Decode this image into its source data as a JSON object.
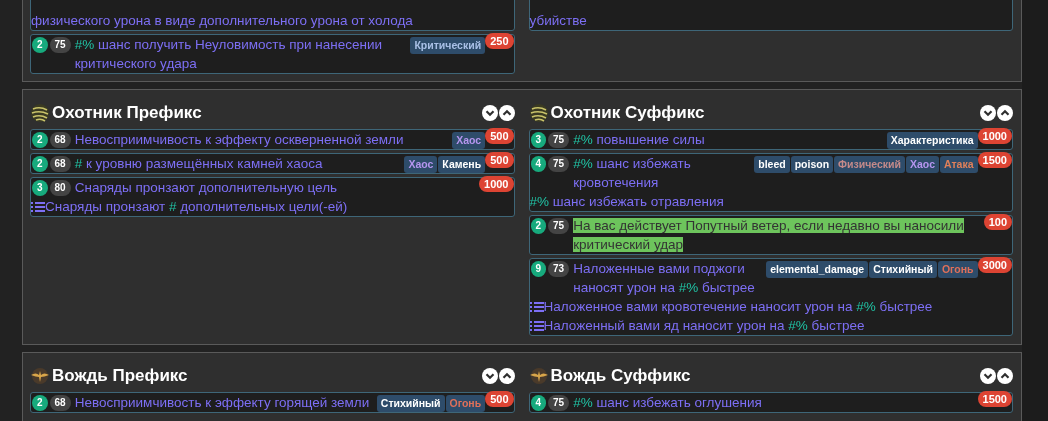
{
  "sections": [
    {
      "columns": [
        {
          "rows": [
            {
              "parts": [
                {
                  "kind": "plain",
                  "text": "физического урона в виде дополнительного урона от холода"
                }
              ],
              "tags": [],
              "highlighted": false,
              "extra": []
            },
            {
              "tier": "2",
              "level": "75",
              "parts": [
                {
                  "kind": "hash",
                  "text": "#%"
                },
                {
                  "kind": "plain",
                  "text": " шанс получить Неуловимость при нанесении критического удара"
                }
              ],
              "tags": [
                {
                  "text": "Критический",
                  "kind": "critical"
                }
              ],
              "weight": "250",
              "highlighted": false,
              "extra": []
            }
          ]
        },
        {
          "rows": [
            {
              "parts": [
                {
                  "kind": "plain",
                  "text": "убийстве"
                }
              ],
              "tags": [],
              "highlighted": false,
              "extra": []
            }
          ]
        }
      ]
    },
    {
      "columns": [
        {
          "title": "Охотник Префикс",
          "kind": "hunter",
          "rows": [
            {
              "tier": "2",
              "level": "68",
              "parts": [
                {
                  "kind": "plain",
                  "text": "Невосприимчивость к эффекту оскверненной земли"
                }
              ],
              "tags": [
                {
                  "text": "Хаос",
                  "kind": "chaos"
                }
              ],
              "weight": "500",
              "highlighted": false,
              "extra": []
            },
            {
              "tier": "2",
              "level": "68",
              "parts": [
                {
                  "kind": "hash",
                  "text": "#"
                },
                {
                  "kind": "plain",
                  "text": " к уровню размещённых камней хаоса"
                }
              ],
              "tags": [
                {
                  "text": "Хаос",
                  "kind": "chaos"
                },
                {
                  "text": "Камень",
                  "kind": "plain"
                }
              ],
              "weight": "500",
              "highlighted": false,
              "extra": []
            },
            {
              "tier": "3",
              "level": "80",
              "parts": [
                {
                  "kind": "plain",
                  "text": "Снаряды пронзают дополнительную цель"
                }
              ],
              "tags": [],
              "weight": "1000",
              "highlighted": false,
              "extra": [
                {
                  "kind": "hybrid",
                  "parts": [
                    {
                      "kind": "plain",
                      "text": "Снаряды пронзают "
                    },
                    {
                      "kind": "hash",
                      "text": "#"
                    },
                    {
                      "kind": "plain",
                      "text": " дополнительных цели(-ей)"
                    }
                  ]
                }
              ]
            }
          ]
        },
        {
          "title": "Охотник Суффикс",
          "kind": "hunter",
          "rows": [
            {
              "tier": "3",
              "level": "75",
              "parts": [
                {
                  "kind": "hash",
                  "text": "#%"
                },
                {
                  "kind": "plain",
                  "text": " повышение силы"
                }
              ],
              "tags": [
                {
                  "text": "Характеристика",
                  "kind": "plain"
                }
              ],
              "weight": "1000",
              "highlighted": false,
              "extra": []
            },
            {
              "tier": "4",
              "level": "75",
              "parts": [
                {
                  "kind": "hash",
                  "text": "#%"
                },
                {
                  "kind": "plain",
                  "text": " шанс избежать кровотечения"
                }
              ],
              "tags": [
                {
                  "text": "bleed",
                  "kind": "plain"
                },
                {
                  "text": "poison",
                  "kind": "plain"
                },
                {
                  "text": "Физический",
                  "kind": "physical"
                },
                {
                  "text": "Хаос",
                  "kind": "chaos"
                },
                {
                  "text": "Атака",
                  "kind": "attack"
                }
              ],
              "weight": "1500",
              "highlighted": false,
              "extra": [
                {
                  "kind": "line",
                  "parts": [
                    {
                      "kind": "hash",
                      "text": "#%"
                    },
                    {
                      "kind": "plain",
                      "text": " шанс избежать отравления"
                    }
                  ]
                }
              ]
            },
            {
              "tier": "2",
              "level": "75",
              "parts": [
                {
                  "kind": "plain",
                  "text": "На вас действует Попутный ветер, если недавно вы наносили критический удар"
                }
              ],
              "tags": [],
              "weight": "100",
              "highlighted": true,
              "extra": []
            },
            {
              "tier": "9",
              "level": "73",
              "parts": [
                {
                  "kind": "plain",
                  "text": "Наложенные вами поджоги наносят урон на "
                },
                {
                  "kind": "hash",
                  "text": "#%"
                },
                {
                  "kind": "plain",
                  "text": " быстрее"
                }
              ],
              "tags": [
                {
                  "text": "elemental_damage",
                  "kind": "plain"
                },
                {
                  "text": "Стихийный",
                  "kind": "plain"
                },
                {
                  "text": "Огонь",
                  "kind": "fire"
                }
              ],
              "weight": "3000",
              "highlighted": false,
              "extra": [
                {
                  "kind": "hybrid",
                  "parts": [
                    {
                      "kind": "plain",
                      "text": "Наложенное вами кровотечение наносит урон на "
                    },
                    {
                      "kind": "hash",
                      "text": "#%"
                    },
                    {
                      "kind": "plain",
                      "text": " быстрее"
                    }
                  ]
                },
                {
                  "kind": "hybrid",
                  "parts": [
                    {
                      "kind": "plain",
                      "text": "Наложенный вами яд наносит урон на "
                    },
                    {
                      "kind": "hash",
                      "text": "#%"
                    },
                    {
                      "kind": "plain",
                      "text": " быстрее"
                    }
                  ]
                }
              ]
            }
          ]
        }
      ]
    },
    {
      "columns": [
        {
          "title": "Вождь Префикс",
          "kind": "chief",
          "rows": [
            {
              "tier": "2",
              "level": "68",
              "parts": [
                {
                  "kind": "plain",
                  "text": "Невосприимчивость к эффекту горящей земли"
                }
              ],
              "tags": [
                {
                  "text": "Стихийный",
                  "kind": "plain"
                },
                {
                  "text": "Огонь",
                  "kind": "fire"
                }
              ],
              "weight": "500",
              "highlighted": false,
              "extra": []
            }
          ]
        },
        {
          "title": "Вождь Суффикс",
          "kind": "chief",
          "rows": [
            {
              "tier": "4",
              "level": "75",
              "parts": [
                {
                  "kind": "hash",
                  "text": "#%"
                },
                {
                  "kind": "plain",
                  "text": " шанс избежать оглушения"
                }
              ],
              "tags": [],
              "weight": "1500",
              "highlighted": false,
              "extra": []
            }
          ]
        }
      ]
    }
  ]
}
